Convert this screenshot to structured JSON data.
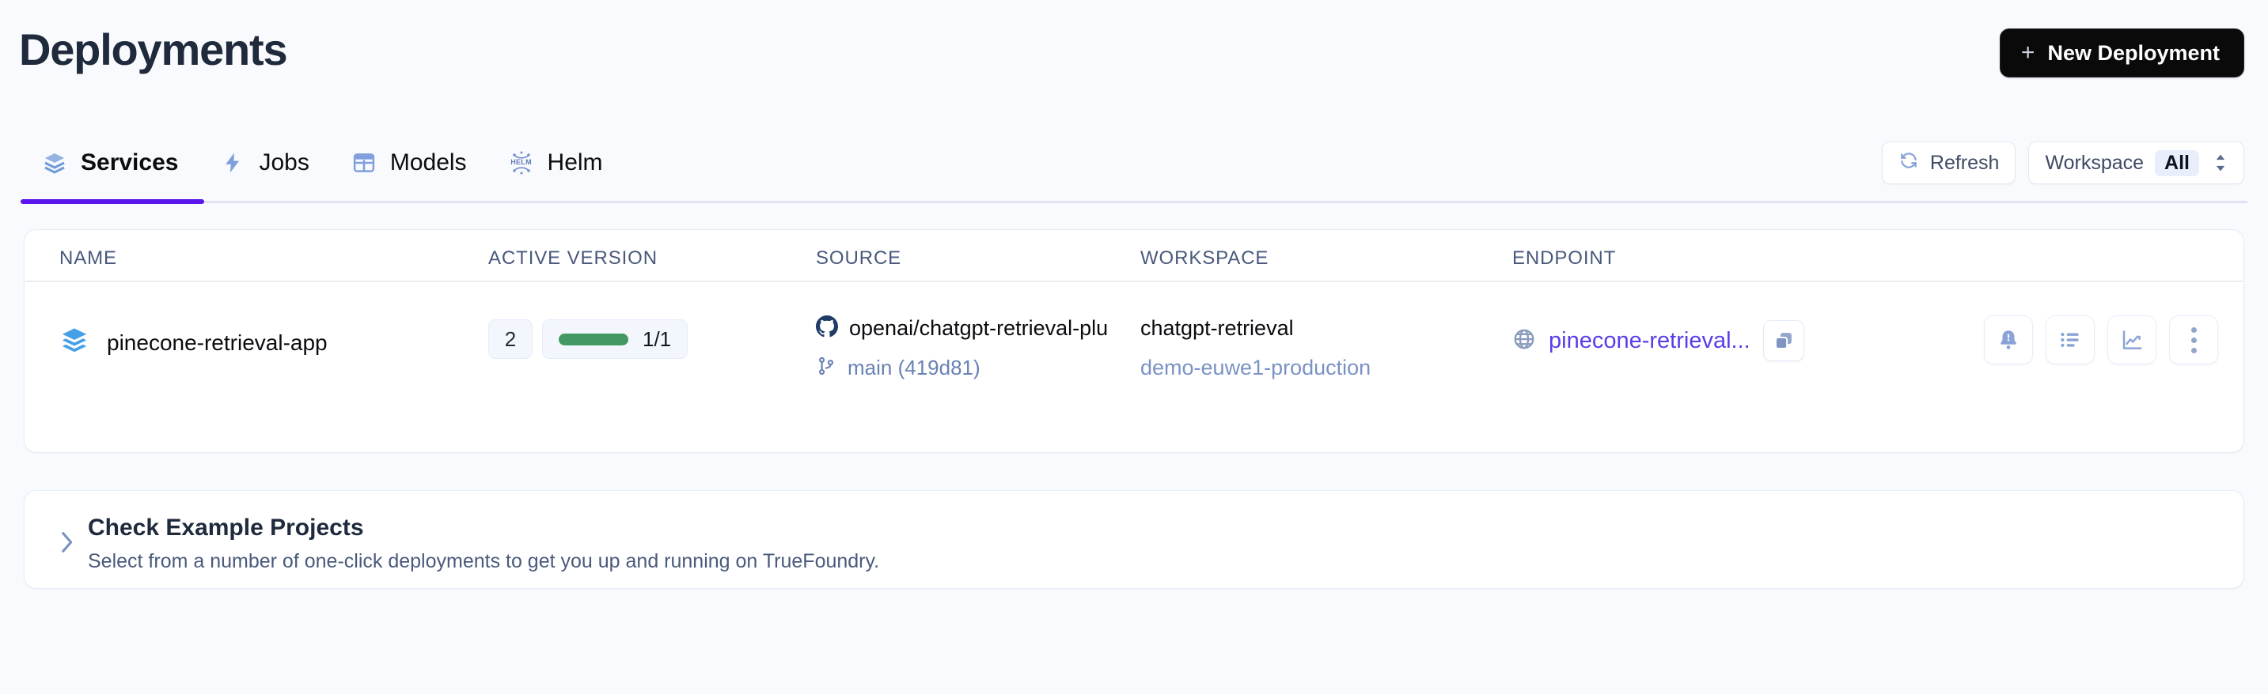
{
  "header": {
    "title": "Deployments",
    "new_deployment_label": "New Deployment",
    "new_deployment_plus": "+"
  },
  "tabs": [
    {
      "label": "Services",
      "icon": "layers-icon",
      "active": true
    },
    {
      "label": "Jobs",
      "icon": "lightning-bolt-icon",
      "active": false
    },
    {
      "label": "Models",
      "icon": "grid-table-icon",
      "active": false
    },
    {
      "label": "Helm",
      "icon": "helm-icon",
      "active": false
    }
  ],
  "controls": {
    "refresh_label": "Refresh",
    "workspace_label": "Workspace",
    "workspace_value": "All"
  },
  "table": {
    "columns": [
      "NAME",
      "ACTIVE VERSION",
      "SOURCE",
      "WORKSPACE",
      "ENDPOINT"
    ],
    "rows": [
      {
        "name": "pinecone-retrieval-app",
        "active_version": "2",
        "replicas": "1/1",
        "source_repo": "openai/chatgpt-retrieval-plu",
        "source_branch": "main (419d81)",
        "workspace_name": "chatgpt-retrieval",
        "workspace_cluster": "demo-euwe1-production",
        "endpoint": "pinecone-retrieval..."
      }
    ]
  },
  "actions": {
    "alerts_label": "Alerts",
    "logs_label": "Logs",
    "metrics_label": "Metrics",
    "more_label": "More"
  },
  "examples": {
    "title": "Check Example Projects",
    "subtitle": "Select from a number of one-click deployments to get you up and running on TrueFoundry."
  },
  "colors": {
    "accent_purple": "#5b16ee",
    "endpoint_link": "#5b3ce8",
    "status_green": "#429a62",
    "page_bg": "#f9fafd",
    "card_bg": "#ffffff",
    "button_dark": "#0a0a0a"
  }
}
